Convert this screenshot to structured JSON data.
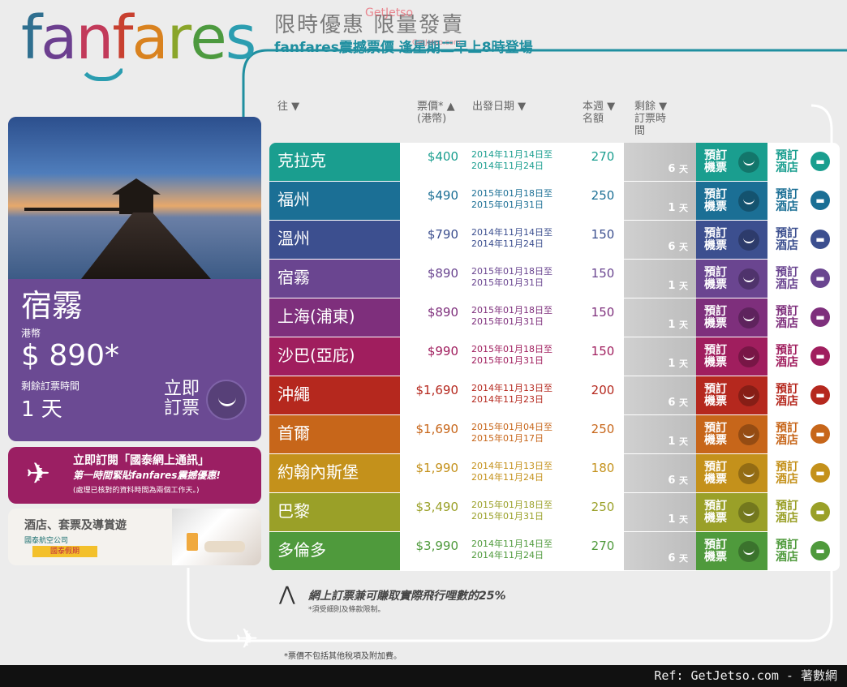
{
  "logo": {
    "text": "fanfares",
    "letters": [
      {
        "ch": "f",
        "color": "#2f6f8f"
      },
      {
        "ch": "a",
        "color": "#6c3f8f"
      },
      {
        "ch": "n",
        "color": "#c23a5a"
      },
      {
        "ch": "f",
        "color": "#c84030"
      },
      {
        "ch": "a",
        "color": "#d9821f"
      },
      {
        "ch": "r",
        "color": "#8aa52a"
      },
      {
        "ch": "e",
        "color": "#4d9a3f"
      },
      {
        "ch": "s",
        "color": "#2b9db0"
      }
    ]
  },
  "headline": "限時優惠 限量發賣",
  "subline": "fanfares震撼票價 逢星期二早上8時登場",
  "watermark": {
    "brand": "GetJetso",
    "url": "GetJetso.com"
  },
  "promo": {
    "destination": "宿霧",
    "currency": "港幣",
    "price": "$ 890*",
    "time_left_label": "剩餘訂票時間",
    "time_left": "1 天",
    "book_label_1": "立即",
    "book_label_2": "訂票"
  },
  "newsletter": {
    "title": "立即訂閱「國泰網上通訊」",
    "subtitle": "第一時間緊貼fanfares震撼優惠!",
    "note": "(處理已核對的資料時間為兩個工作天。)"
  },
  "hotel_promo": {
    "title": "酒店、套票及導賞遊",
    "airline": "國泰航空公司",
    "badge": "國泰假期"
  },
  "table_header": {
    "dest": "往 ▼",
    "price": "票價* ▲",
    "price_unit": "(港幣)",
    "date": "出發日期 ▼",
    "seats_1": "本週 ▼",
    "seats_2": "名額",
    "left_1": "剩餘 ▼",
    "left_2": "訂票時",
    "left_3": "間"
  },
  "book_flight": {
    "line1": "預訂",
    "line2": "機票"
  },
  "book_hotel": {
    "line1": "預訂",
    "line2": "酒店"
  },
  "day_unit": "天",
  "rows": [
    {
      "dest": "克拉克",
      "price": "$400",
      "date1": "2014年11月14日至",
      "date2": "2014年11月24日",
      "seats": "270",
      "left": "6",
      "color": "#1a9e8f"
    },
    {
      "dest": "福州",
      "price": "$490",
      "date1": "2015年01月18日至",
      "date2": "2015年01月31日",
      "seats": "250",
      "left": "1",
      "color": "#1b6f95"
    },
    {
      "dest": "溫州",
      "price": "$790",
      "date1": "2014年11月14日至",
      "date2": "2014年11月24日",
      "seats": "150",
      "left": "6",
      "color": "#3c4f8f"
    },
    {
      "dest": "宿霧",
      "price": "$890",
      "date1": "2015年01月18日至",
      "date2": "2015年01月31日",
      "seats": "150",
      "left": "1",
      "color": "#6a4590"
    },
    {
      "dest": "上海(浦東)",
      "price": "$890",
      "date1": "2015年01月18日至",
      "date2": "2015年01月31日",
      "seats": "150",
      "left": "1",
      "color": "#7e2f7c"
    },
    {
      "dest": "沙巴(亞庇)",
      "price": "$990",
      "date1": "2015年01月18日至",
      "date2": "2015年01月31日",
      "seats": "150",
      "left": "1",
      "color": "#a01e5e"
    },
    {
      "dest": "沖繩",
      "price": "$1,690",
      "date1": "2014年11月13日至",
      "date2": "2014年11月23日",
      "seats": "200",
      "left": "6",
      "color": "#b5281e"
    },
    {
      "dest": "首爾",
      "price": "$1,690",
      "date1": "2015年01月04日至",
      "date2": "2015年01月17日",
      "seats": "250",
      "left": "1",
      "color": "#c7661a"
    },
    {
      "dest": "約翰內斯堡",
      "price": "$1,990",
      "date1": "2014年11月13日至",
      "date2": "2014年11月24日",
      "seats": "180",
      "left": "6",
      "color": "#c4911b"
    },
    {
      "dest": "巴黎",
      "price": "$3,490",
      "date1": "2015年01月18日至",
      "date2": "2015年01月31日",
      "seats": "250",
      "left": "1",
      "color": "#9aa028"
    },
    {
      "dest": "多倫多",
      "price": "$3,990",
      "date1": "2014年11月14日至",
      "date2": "2014年11月24日",
      "seats": "270",
      "left": "6",
      "color": "#4f9a3c"
    }
  ],
  "miles": {
    "text": "網上訂票兼可賺取實際飛行哩數的25%",
    "note": "*須受細則及條款限制。"
  },
  "footnote": "*票價不包括其他稅項及附加費。",
  "footer": "Ref: GetJetso.com - 著數網"
}
